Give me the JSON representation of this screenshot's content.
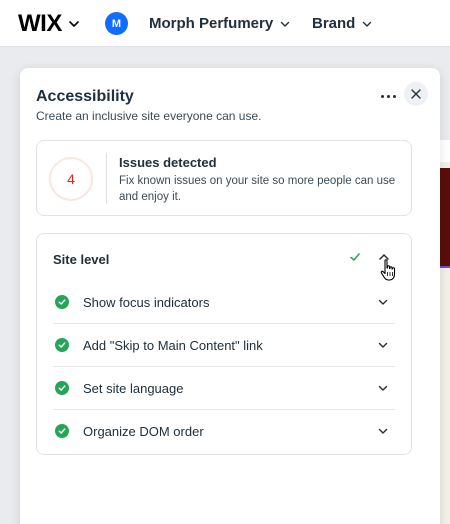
{
  "topbar": {
    "logo": "WIX",
    "avatar_initial": "M",
    "site_name": "Morph Perfumery",
    "brand_menu": "Brand"
  },
  "panel": {
    "title": "Accessibility",
    "subtitle": "Create an inclusive site everyone can use.",
    "issues": {
      "count": "4",
      "title": "Issues detected",
      "description": "Fix known issues on your site so more people can use and enjoy it."
    },
    "site_level": {
      "title": "Site level",
      "items": [
        {
          "label": "Show focus indicators"
        },
        {
          "label": "Add \"Skip to Main Content\" link"
        },
        {
          "label": "Set site language"
        },
        {
          "label": "Organize DOM order"
        }
      ]
    }
  },
  "colors": {
    "accent_blue": "#116dff",
    "success_green": "#25a55a",
    "issue_red": "#e62214"
  },
  "icons": {
    "logo_chevron": "chevron-down-icon",
    "more": "more-horizontal-icon",
    "close": "close-icon",
    "site_check": "checkmark-icon",
    "site_toggle": "chevron-up-icon",
    "row_status": "check-circle-icon",
    "row_toggle": "chevron-down-icon",
    "cursor": "hand-pointer-icon"
  }
}
